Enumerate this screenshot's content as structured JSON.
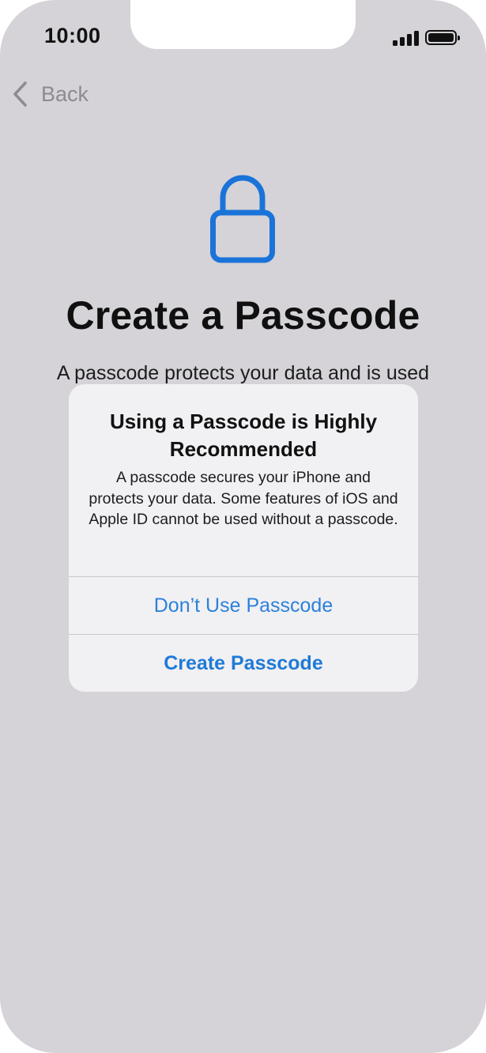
{
  "status_bar": {
    "time": "10:00",
    "signal_icon": "cellular-signal-icon",
    "battery_icon": "battery-icon"
  },
  "nav": {
    "back_label": "Back",
    "back_icon": "chevron-left-icon"
  },
  "screen": {
    "icon": "lock-icon",
    "icon_color": "#1a73d9",
    "title": "Create a Passcode",
    "subtitle": "A passcode protects your data and is used"
  },
  "alert": {
    "title": "Using a Passcode is Highly Recommended",
    "message": "A passcode secures your iPhone and protects your data. Some features of iOS and Apple ID cannot be used without a passcode.",
    "buttons": [
      {
        "label": "Don’t Use Passcode",
        "style": "default"
      },
      {
        "label": "Create Passcode",
        "style": "preferred"
      }
    ],
    "accent_color": "#2b81db"
  }
}
